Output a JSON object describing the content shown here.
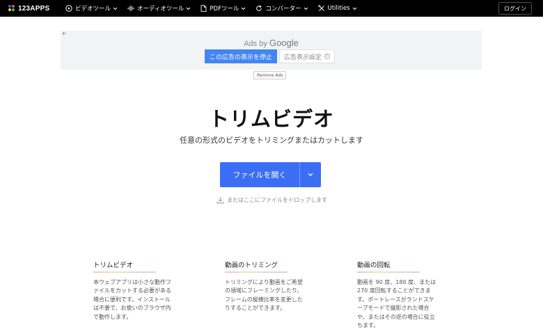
{
  "brand": {
    "name": "123APPS",
    "dot_colors": [
      "#2f6bff",
      "#ff4b4b",
      "#ffc93c",
      "#35c46a"
    ]
  },
  "nav": {
    "items": [
      {
        "label": "ビデオツール",
        "icon": "video-play-icon"
      },
      {
        "label": "オーディオツール",
        "icon": "audio-wave-icon"
      },
      {
        "label": "PDFツール",
        "icon": "pdf-document-icon"
      },
      {
        "label": "コンバーター",
        "icon": "converter-refresh-icon"
      },
      {
        "label": "Utilities",
        "icon": "tools-icon"
      }
    ],
    "login_label": "ログイン"
  },
  "ad": {
    "ads_by": "Ads by",
    "google": "Google",
    "stop_label": "この広告の表示を停止",
    "settings_label": "広告表示設定",
    "remove_ads_label": "Remove Ads"
  },
  "hero": {
    "title": "トリムビデオ",
    "subtitle": "任意の形式のビデオをトリミングまたはカットします",
    "open_button_label": "ファイルを開く",
    "drop_hint": "またはここにファイルをドロップします",
    "accent_color": "#3b6ef5"
  },
  "features": [
    {
      "title": "トリムビデオ",
      "lines": [
        "本ウェブアプリは小さな動作フ",
        "ァイルをカットする必要がある",
        "場合に便利です。インストール",
        "は不要で、お使いのブラウザ内",
        "で動作します。"
      ]
    },
    {
      "title": "動画のトリミング",
      "lines": [
        "トリミングにより動画をご希望",
        "の領域にフレーミングしたり、",
        "フレームの縦横比率を変更した",
        "りすることができます。"
      ]
    },
    {
      "title": "動画の回転",
      "lines": [
        "動画を 90 度、180 度、または",
        "270 度回転することができま",
        "す。ポートレースがランドスケ",
        "ープモードで撮影された場合",
        "や、またはその逆の場合に役立",
        "ちます。"
      ]
    }
  ]
}
